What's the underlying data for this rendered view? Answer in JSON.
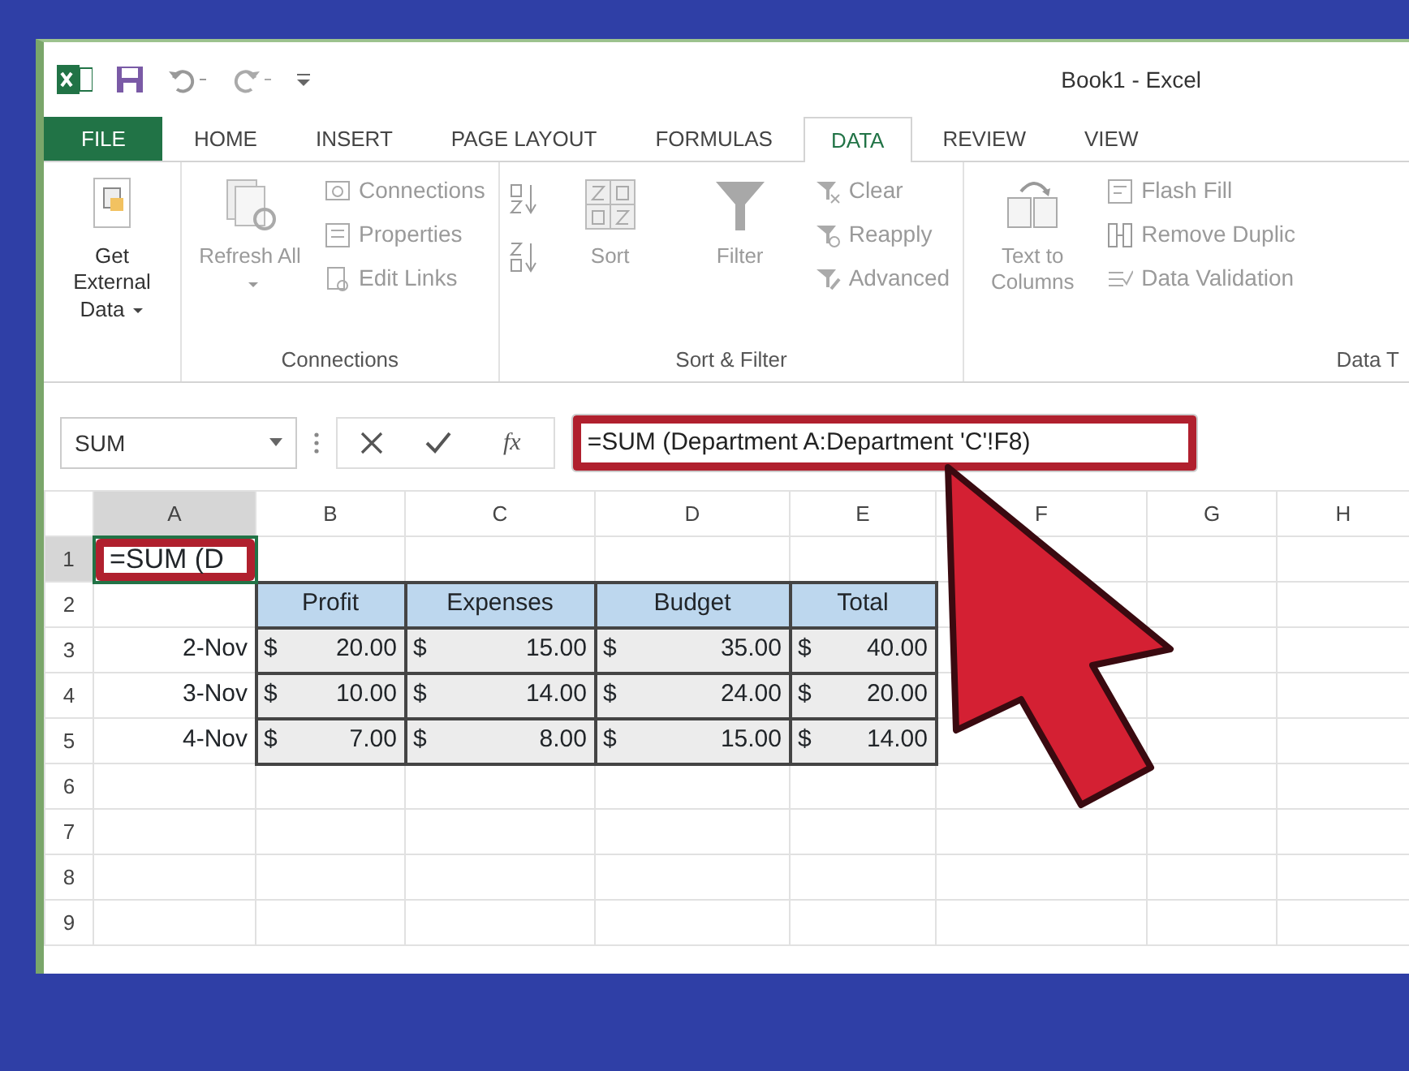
{
  "window": {
    "title": "Book1 - Excel"
  },
  "tabs": [
    {
      "label": "FILE",
      "kind": "file",
      "selected": false
    },
    {
      "label": "HOME",
      "kind": "tab",
      "selected": false
    },
    {
      "label": "INSERT",
      "kind": "tab",
      "selected": false
    },
    {
      "label": "PAGE LAYOUT",
      "kind": "tab",
      "selected": false
    },
    {
      "label": "FORMULAS",
      "kind": "tab",
      "selected": false
    },
    {
      "label": "DATA",
      "kind": "tab",
      "selected": true
    },
    {
      "label": "REVIEW",
      "kind": "tab",
      "selected": false
    },
    {
      "label": "VIEW",
      "kind": "tab",
      "selected": false
    }
  ],
  "ribbon": {
    "groups": [
      {
        "items": [
          {
            "kind": "large",
            "label": "Get External Data",
            "caret": true,
            "disabled": false
          }
        ]
      },
      {
        "label": "Connections",
        "items": [
          {
            "kind": "large",
            "label": "Refresh All",
            "caret": true,
            "disabled": true
          },
          {
            "kind": "stack",
            "entries": [
              {
                "label": "Connections",
                "disabled": true
              },
              {
                "label": "Properties",
                "disabled": true
              },
              {
                "label": "Edit Links",
                "disabled": true
              }
            ]
          }
        ]
      },
      {
        "label": "Sort & Filter",
        "items": [
          {
            "kind": "sort-pair",
            "disabled": true
          },
          {
            "kind": "large",
            "label": "Sort",
            "caret": false,
            "disabled": true
          },
          {
            "kind": "large",
            "label": "Filter",
            "caret": false,
            "disabled": true
          },
          {
            "kind": "stack",
            "entries": [
              {
                "label": "Clear",
                "disabled": true
              },
              {
                "label": "Reapply",
                "disabled": true
              },
              {
                "label": "Advanced",
                "disabled": true
              }
            ]
          }
        ]
      },
      {
        "label": "Data T",
        "items": [
          {
            "kind": "large",
            "label": "Text to Columns",
            "caret": false,
            "disabled": true
          },
          {
            "kind": "stack",
            "entries": [
              {
                "label": "Flash Fill",
                "disabled": true
              },
              {
                "label": "Remove Duplic",
                "disabled": true
              },
              {
                "label": "Data Validation",
                "disabled": true
              }
            ]
          }
        ]
      }
    ]
  },
  "formula_bar": {
    "name_box": "SUM",
    "function_button": "fx",
    "formula": "=SUM (Department A:Department 'C'!F8)",
    "highlighted": true
  },
  "sheet": {
    "columns": [
      {
        "label": "A",
        "selected": true
      },
      {
        "label": "B",
        "selected": false
      },
      {
        "label": "C",
        "selected": false
      },
      {
        "label": "D",
        "selected": false
      },
      {
        "label": "E",
        "selected": false
      },
      {
        "label": "F",
        "selected": false
      },
      {
        "label": "G",
        "selected": false
      },
      {
        "label": "H",
        "selected": false
      }
    ],
    "rows": [
      {
        "number": "1",
        "selected": true,
        "cells": [
          {
            "kind": "formula",
            "text": "=SUM (D",
            "highlighted": true
          }
        ]
      },
      {
        "number": "2",
        "selected": false,
        "cells": [
          {
            "kind": "empty"
          },
          {
            "kind": "header",
            "text": "Profit"
          },
          {
            "kind": "header",
            "text": "Expenses"
          },
          {
            "kind": "header",
            "text": "Budget"
          },
          {
            "kind": "header",
            "text": "Total"
          }
        ]
      },
      {
        "number": "3",
        "selected": false,
        "cells": [
          {
            "kind": "date",
            "text": "2-Nov"
          },
          {
            "kind": "money",
            "currency": "$",
            "amount": "20.00"
          },
          {
            "kind": "money",
            "currency": "$",
            "amount": "15.00"
          },
          {
            "kind": "money",
            "currency": "$",
            "amount": "35.00"
          },
          {
            "kind": "money",
            "currency": "$",
            "amount": "40.00"
          }
        ]
      },
      {
        "number": "4",
        "selected": false,
        "cells": [
          {
            "kind": "date",
            "text": "3-Nov"
          },
          {
            "kind": "money",
            "currency": "$",
            "amount": "10.00"
          },
          {
            "kind": "money",
            "currency": "$",
            "amount": "14.00"
          },
          {
            "kind": "money",
            "currency": "$",
            "amount": "24.00"
          },
          {
            "kind": "money",
            "currency": "$",
            "amount": "20.00"
          }
        ]
      },
      {
        "number": "5",
        "selected": false,
        "cells": [
          {
            "kind": "date",
            "text": "4-Nov"
          },
          {
            "kind": "money",
            "currency": "$",
            "amount": "7.00"
          },
          {
            "kind": "money",
            "currency": "$",
            "amount": "8.00"
          },
          {
            "kind": "money",
            "currency": "$",
            "amount": "15.00"
          },
          {
            "kind": "money",
            "currency": "$",
            "amount": "14.00"
          }
        ]
      },
      {
        "number": "6",
        "selected": false,
        "cells": []
      },
      {
        "number": "7",
        "selected": false,
        "cells": []
      },
      {
        "number": "8",
        "selected": false,
        "cells": []
      },
      {
        "number": "9",
        "selected": false,
        "cells": []
      }
    ]
  }
}
